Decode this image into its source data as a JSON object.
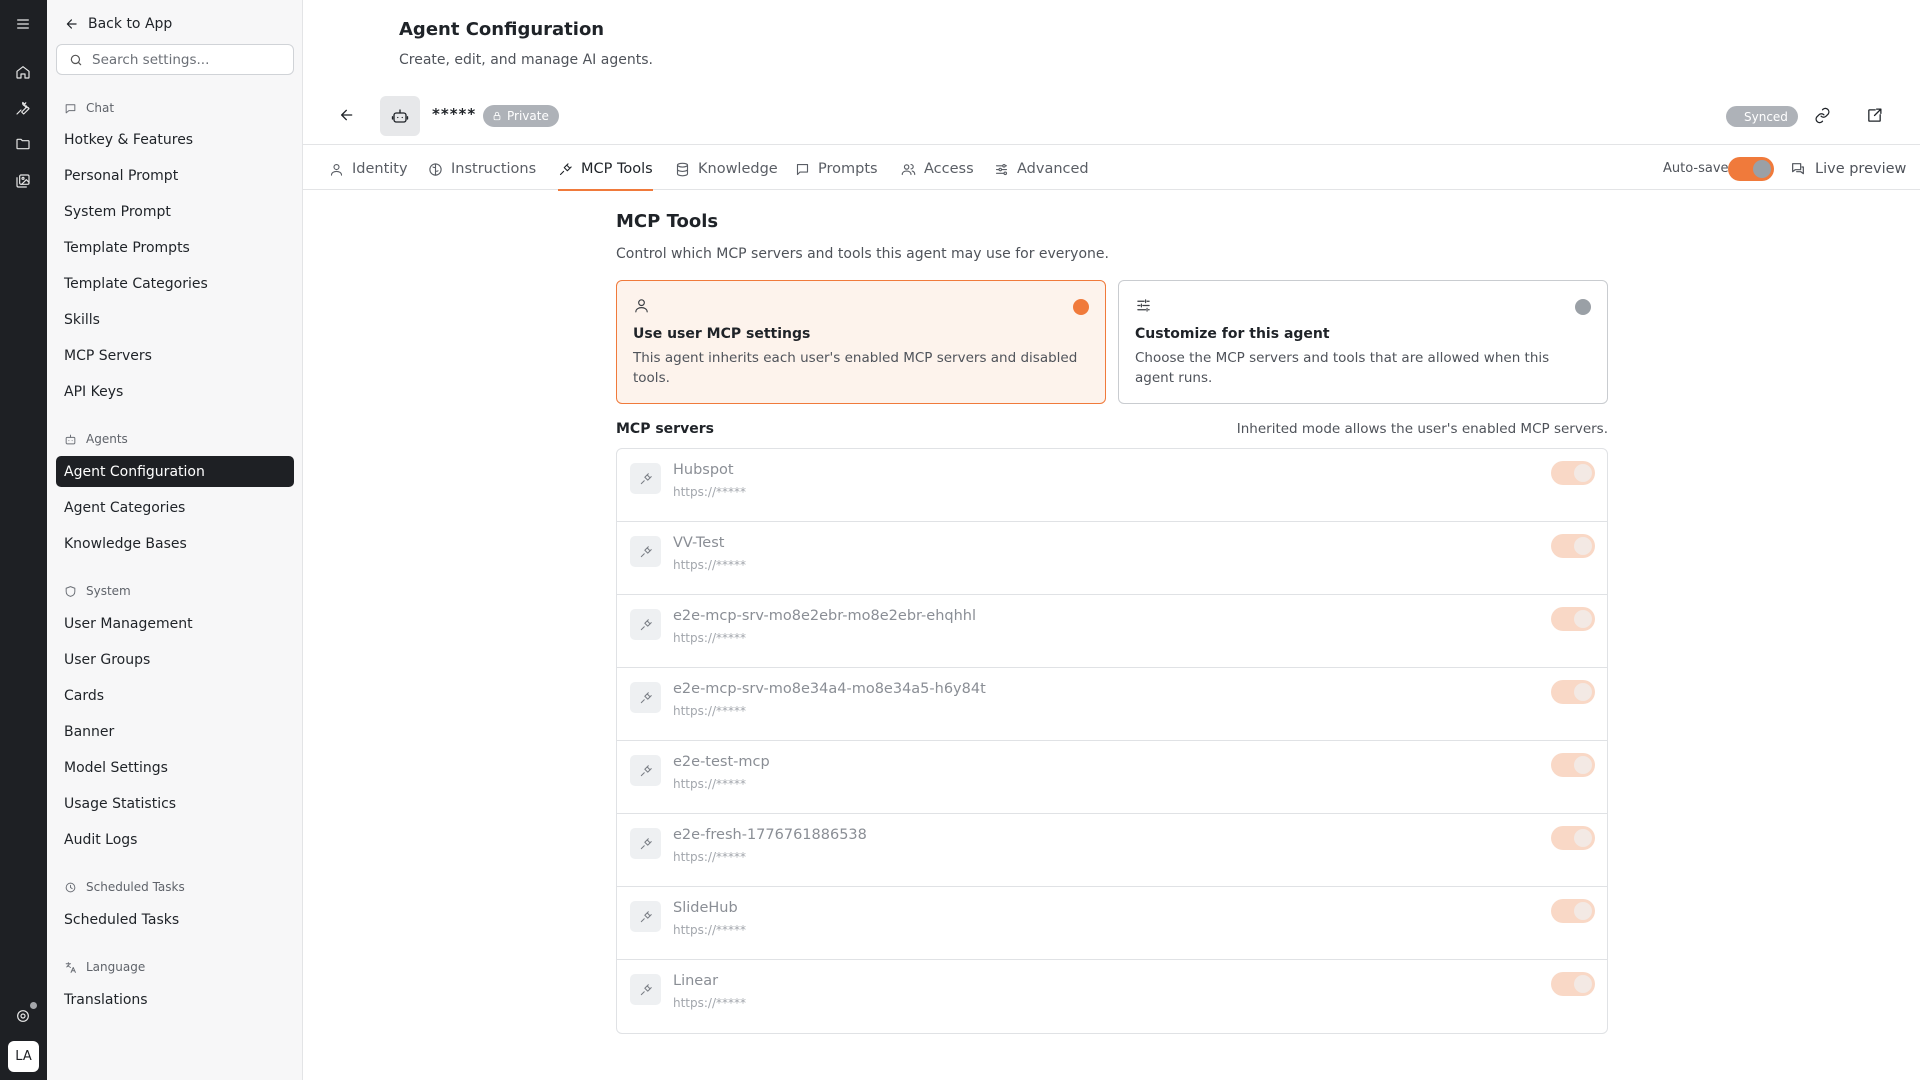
{
  "sidebar": {
    "back_label": "Back to App",
    "search_placeholder": "Search settings...",
    "sections": {
      "chat": {
        "label": "Chat",
        "items": [
          "Hotkey & Features",
          "Personal Prompt",
          "System Prompt",
          "Template Prompts",
          "Template Categories",
          "Skills",
          "MCP Servers",
          "API Keys"
        ]
      },
      "agents": {
        "label": "Agents",
        "items": [
          "Agent Configuration",
          "Agent Categories",
          "Knowledge Bases"
        ],
        "active": "Agent Configuration"
      },
      "system": {
        "label": "System",
        "items": [
          "User Management",
          "User Groups",
          "Cards",
          "Banner",
          "Model Settings",
          "Usage Statistics",
          "Audit Logs"
        ]
      },
      "scheduled": {
        "label": "Scheduled Tasks",
        "items": [
          "Scheduled Tasks"
        ]
      },
      "language": {
        "label": "Language",
        "items": [
          "Translations"
        ]
      }
    }
  },
  "rail": {
    "icons": [
      "menu-icon",
      "home-icon",
      "wrench-icon",
      "folder-icon",
      "images-icon",
      "support-icon"
    ],
    "avatar_initials": "LA"
  },
  "header": {
    "title": "Agent Configuration",
    "subtitle": "Create, edit, and manage AI agents."
  },
  "agent": {
    "name": "*****",
    "visibility": "Private",
    "sync_status": "Synced"
  },
  "tabs": [
    {
      "label": "Identity",
      "icon": "user-icon"
    },
    {
      "label": "Instructions",
      "icon": "brain-icon"
    },
    {
      "label": "MCP Tools",
      "icon": "plug-icon",
      "active": true
    },
    {
      "label": "Knowledge",
      "icon": "database-icon"
    },
    {
      "label": "Prompts",
      "icon": "message-square-icon"
    },
    {
      "label": "Access",
      "icon": "users-icon"
    },
    {
      "label": "Advanced",
      "icon": "sliders-icon"
    }
  ],
  "toolbar": {
    "autosave_label": "Auto-save",
    "autosave_on": true,
    "live_preview_label": "Live preview"
  },
  "content": {
    "title": "MCP Tools",
    "description": "Control which MCP servers and tools this agent may use for everyone.",
    "modes": [
      {
        "title": "Use user MCP settings",
        "description": "This agent inherits each user's enabled MCP servers and disabled tools.",
        "selected": true
      },
      {
        "title": "Customize for this agent",
        "description": "Choose the MCP servers and tools that are allowed when this agent runs.",
        "selected": false
      }
    ],
    "servers_label": "MCP servers",
    "servers_note": "Inherited mode allows the user's enabled MCP servers.",
    "servers": [
      {
        "name": "Hubspot",
        "url": "https://*****",
        "enabled": true
      },
      {
        "name": "VV-Test",
        "url": "https://*****",
        "enabled": true
      },
      {
        "name": "e2e-mcp-srv-mo8e2ebr-mo8e2ebr-ehqhhl",
        "url": "https://*****",
        "enabled": true
      },
      {
        "name": "e2e-mcp-srv-mo8e34a4-mo8e34a5-h6y84t",
        "url": "https://*****",
        "enabled": true
      },
      {
        "name": "e2e-test-mcp",
        "url": "https://*****",
        "enabled": true
      },
      {
        "name": "e2e-fresh-1776761886538",
        "url": "https://*****",
        "enabled": true
      },
      {
        "name": "SlideHub",
        "url": "https://*****",
        "enabled": true
      },
      {
        "name": "Linear",
        "url": "https://*****",
        "enabled": true
      }
    ]
  },
  "colors": {
    "accent": "#f07a3b",
    "rail_bg": "#1e2024",
    "active_nav_bg": "#1e2024"
  }
}
